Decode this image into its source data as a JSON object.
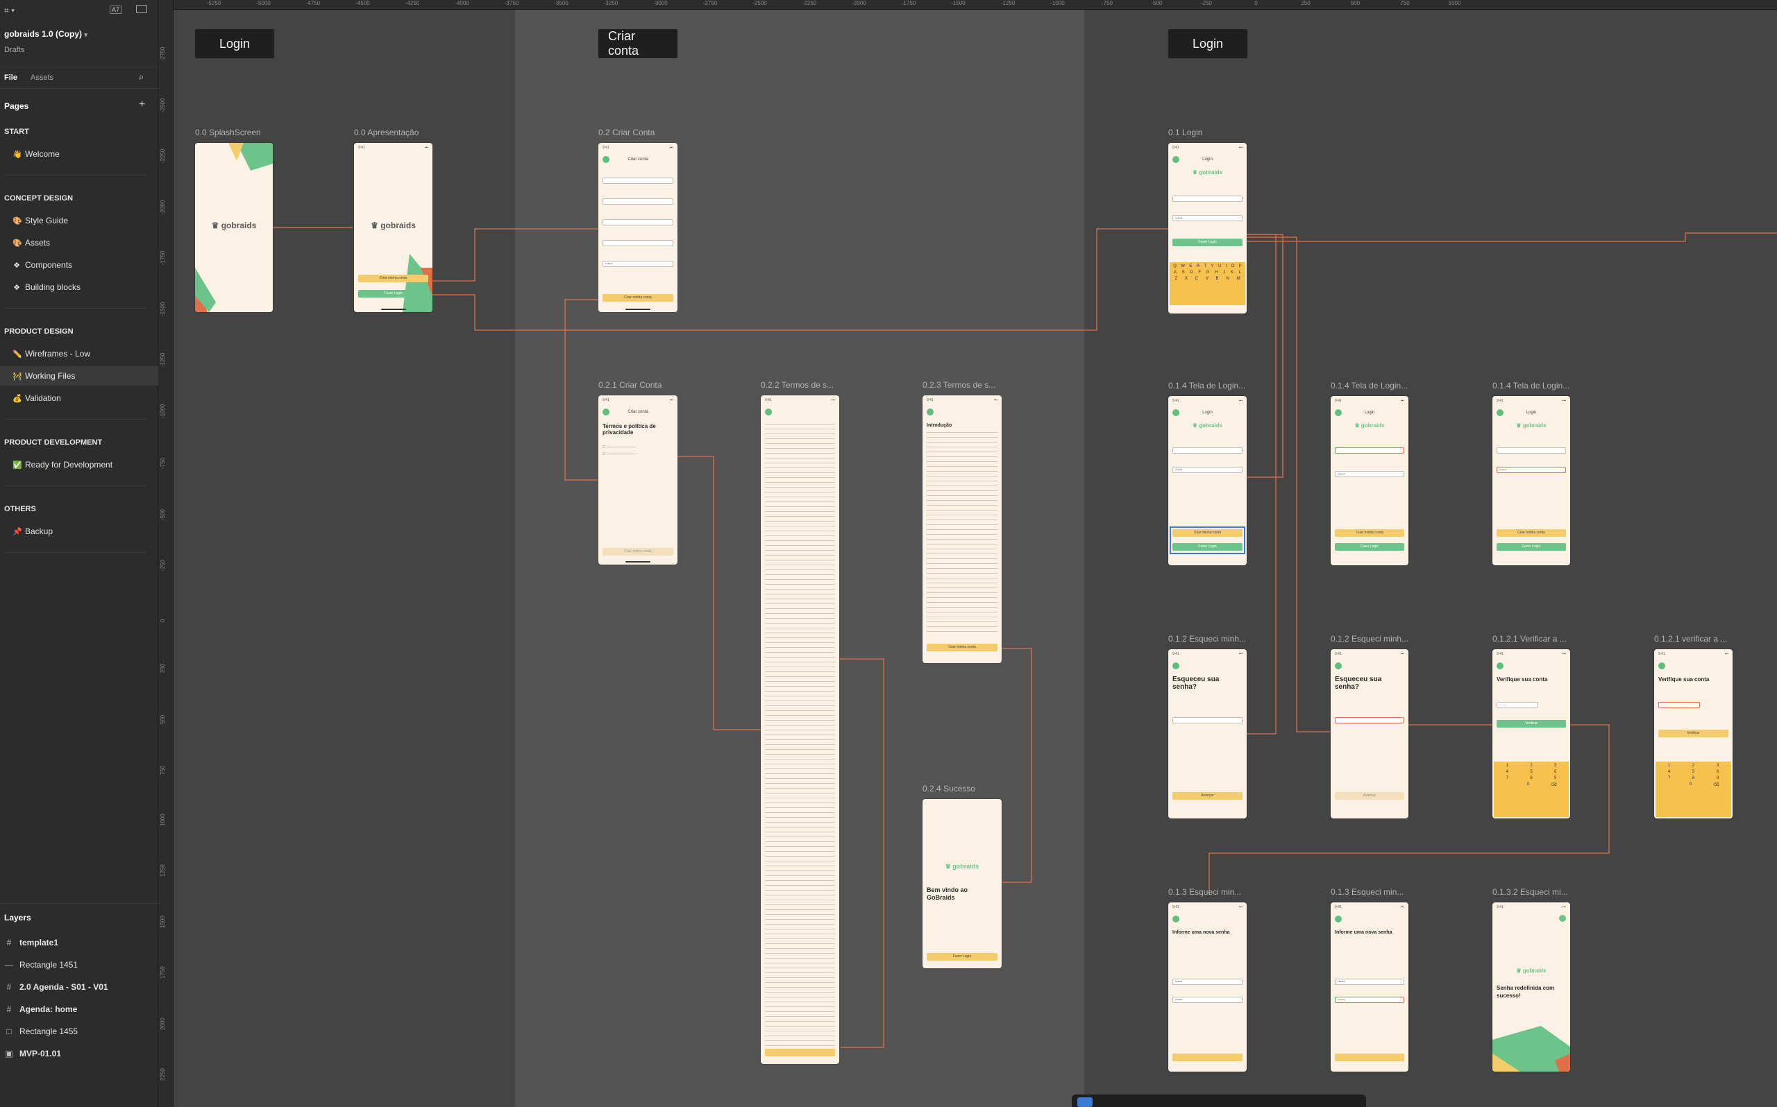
{
  "app": {
    "file_name": "gobraids 1.0 (Copy)",
    "project": "Drafts",
    "zoom_badge": "A7"
  },
  "panel_tabs": {
    "file": "File",
    "assets": "Assets"
  },
  "pages": {
    "header": "Pages",
    "sections": [
      {
        "title": "START",
        "items": [
          {
            "label": "Welcome",
            "icon": "👋"
          }
        ]
      },
      {
        "title": "CONCEPT DESIGN",
        "items": [
          {
            "label": "Style Guide",
            "icon": "🎨"
          },
          {
            "label": "Assets",
            "icon": "🎨"
          },
          {
            "label": "Components",
            "icon": "❖"
          },
          {
            "label": "Building blocks",
            "icon": "❖"
          }
        ]
      },
      {
        "title": "PRODUCT DESIGN",
        "items": [
          {
            "label": "Wireframes  - Low",
            "icon": "✏️"
          },
          {
            "label": "Working Files",
            "icon": "🚧"
          },
          {
            "label": "Validation",
            "icon": "💰"
          }
        ]
      },
      {
        "title": "PRODUCT DEVELOPMENT",
        "items": [
          {
            "label": "Ready for Development",
            "icon": "✅"
          }
        ]
      },
      {
        "title": "OTHERS",
        "items": [
          {
            "label": "Backup",
            "icon": "📌"
          }
        ]
      }
    ]
  },
  "layers": {
    "header": "Layers",
    "items": [
      {
        "label": "template1",
        "icon": "#"
      },
      {
        "label": "Rectangle 1451",
        "icon": "—"
      },
      {
        "label": "2.0 Agenda - S01 - V01",
        "icon": "#"
      },
      {
        "label": "Agenda: home",
        "icon": "#"
      },
      {
        "label": "Rectangle 1455",
        "icon": "□"
      },
      {
        "label": "MVP-01.01",
        "icon": "▣"
      }
    ]
  },
  "rulers": {
    "top": [
      "-5250",
      "-5000",
      "-4750",
      "-4500",
      "-4250",
      "-4000",
      "-3750",
      "-3500",
      "-3250",
      "-3000",
      "-2750",
      "-2500",
      "-2250",
      "-2000",
      "-1750",
      "-1500",
      "-1250",
      "-1000",
      "-750",
      "-500",
      "-250",
      "0",
      "250",
      "500",
      "750",
      "1000"
    ],
    "left": [
      "-2750",
      "-2500",
      "-2250",
      "-2000",
      "-1750",
      "-1500",
      "-1250",
      "-1000",
      "-750",
      "-500",
      "-250",
      "0",
      "250",
      "500",
      "750",
      "1000",
      "1250",
      "1500",
      "1750",
      "2000",
      "2250"
    ]
  },
  "canvas": {
    "section_labels": {
      "login_left": "Login",
      "criar_conta": "Criar conta",
      "login_right": "Login"
    },
    "frames": {
      "splash": "0.0 SplashScreen",
      "apresentacao": "0.0 Apresentação",
      "criar_conta": "0.2 Criar Conta",
      "criar_conta_2": "0.2.1 Criar Conta",
      "termos": "0.2.2 Termos de s...",
      "termos_2": "0.2.3 Termos de s...",
      "sucesso": "0.2.4 Sucesso",
      "login": "0.1 Login",
      "tela_login_a": "0.1.4 Tela de Login...",
      "tela_login_b": "0.1.4 Tela de Login...",
      "tela_login_c": "0.1.4 Tela de Login...",
      "esqueci_a": "0.1.2 Esqueci minh...",
      "esqueci_b": "0.1.2 Esqueci minh...",
      "verificar_a": "0.1.2.1  Verificar a ...",
      "verificar_b": "0.1.2.1  verificar a ...",
      "esqueci_c": "0.1.3  Esqueci min...",
      "esqueci_d": "0.1.3  Esqueci min...",
      "esqueci_e": "0.1.3.2 Esqueci mi..."
    },
    "screen_text": {
      "brand": "gobraids",
      "criar_conta_title": "Criar conta",
      "termos_heading": "Termos e política de privacidade",
      "introducao": "Introdução",
      "bem_vindo": "Bem vindo ao GoBraids",
      "esqueceu": "Esqueceu sua senha?",
      "verifique": "Verifique sua conta",
      "nova_senha": "Informe uma nova senha",
      "senha_redefinida": "Senha redefinida com sucesso!",
      "login_title": "Login",
      "entrar": "Fazer Login",
      "criar_btn": "Criar minha conta",
      "avancar": "Avançar",
      "verificar_btn": "Verificar"
    }
  },
  "colors": {
    "accent_green": "#6cc48a",
    "accent_yellow": "#f5cc6b",
    "connector": "#e0704a",
    "phone_bg": "#fbf1e4"
  }
}
